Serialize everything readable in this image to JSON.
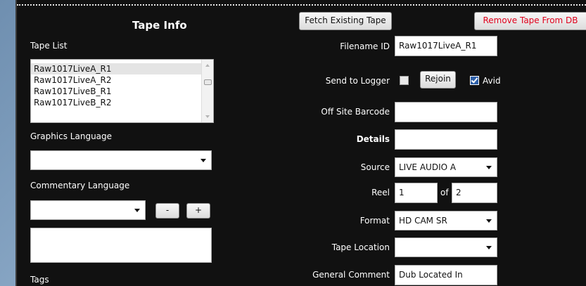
{
  "left_panel": {
    "title": "Tape Info",
    "tape_list_label": "Tape List",
    "tapes": [
      "Raw1017LiveA_R1",
      "Raw1017LiveA_R2",
      "Raw1017LiveB_R1",
      "Raw1017LiveB_R2"
    ],
    "selected_tape_index": 0,
    "graphics_language_label": "Graphics Language",
    "graphics_language_value": "",
    "commentary_language_label": "Commentary Language",
    "commentary_language_value": "",
    "minus_label": "-",
    "plus_label": "+",
    "commentary_list_items": [],
    "tags_label": "Tags"
  },
  "right_panel": {
    "fetch_button_label": "Fetch Existing Tape",
    "remove_button_label": "Remove Tape From DB",
    "filename_id_label": "Filename ID",
    "filename_id_value": "Raw1017LiveA_R1",
    "send_to_logger_label": "Send to Logger",
    "send_to_logger_checked": false,
    "rejoin_label": "Rejoin",
    "avid_label": "Avid",
    "avid_checked": true,
    "off_site_barcode_label": "Off Site Barcode",
    "off_site_barcode_value": "",
    "details_label": "Details",
    "details_value": "",
    "source_label": "Source",
    "source_value": "LIVE AUDIO A",
    "reel_label": "Reel",
    "reel_value": "1",
    "of_label": "of",
    "reel_total": "2",
    "format_label": "Format",
    "format_value": "HD CAM SR",
    "tape_location_label": "Tape Location",
    "tape_location_value": "",
    "general_comment_label": "General Comment",
    "general_comment_value": "Dub Located In"
  },
  "colors": {
    "panel_background": "#111111",
    "remove_text": "#e0001b",
    "avid_check": "#2d5fa8"
  }
}
